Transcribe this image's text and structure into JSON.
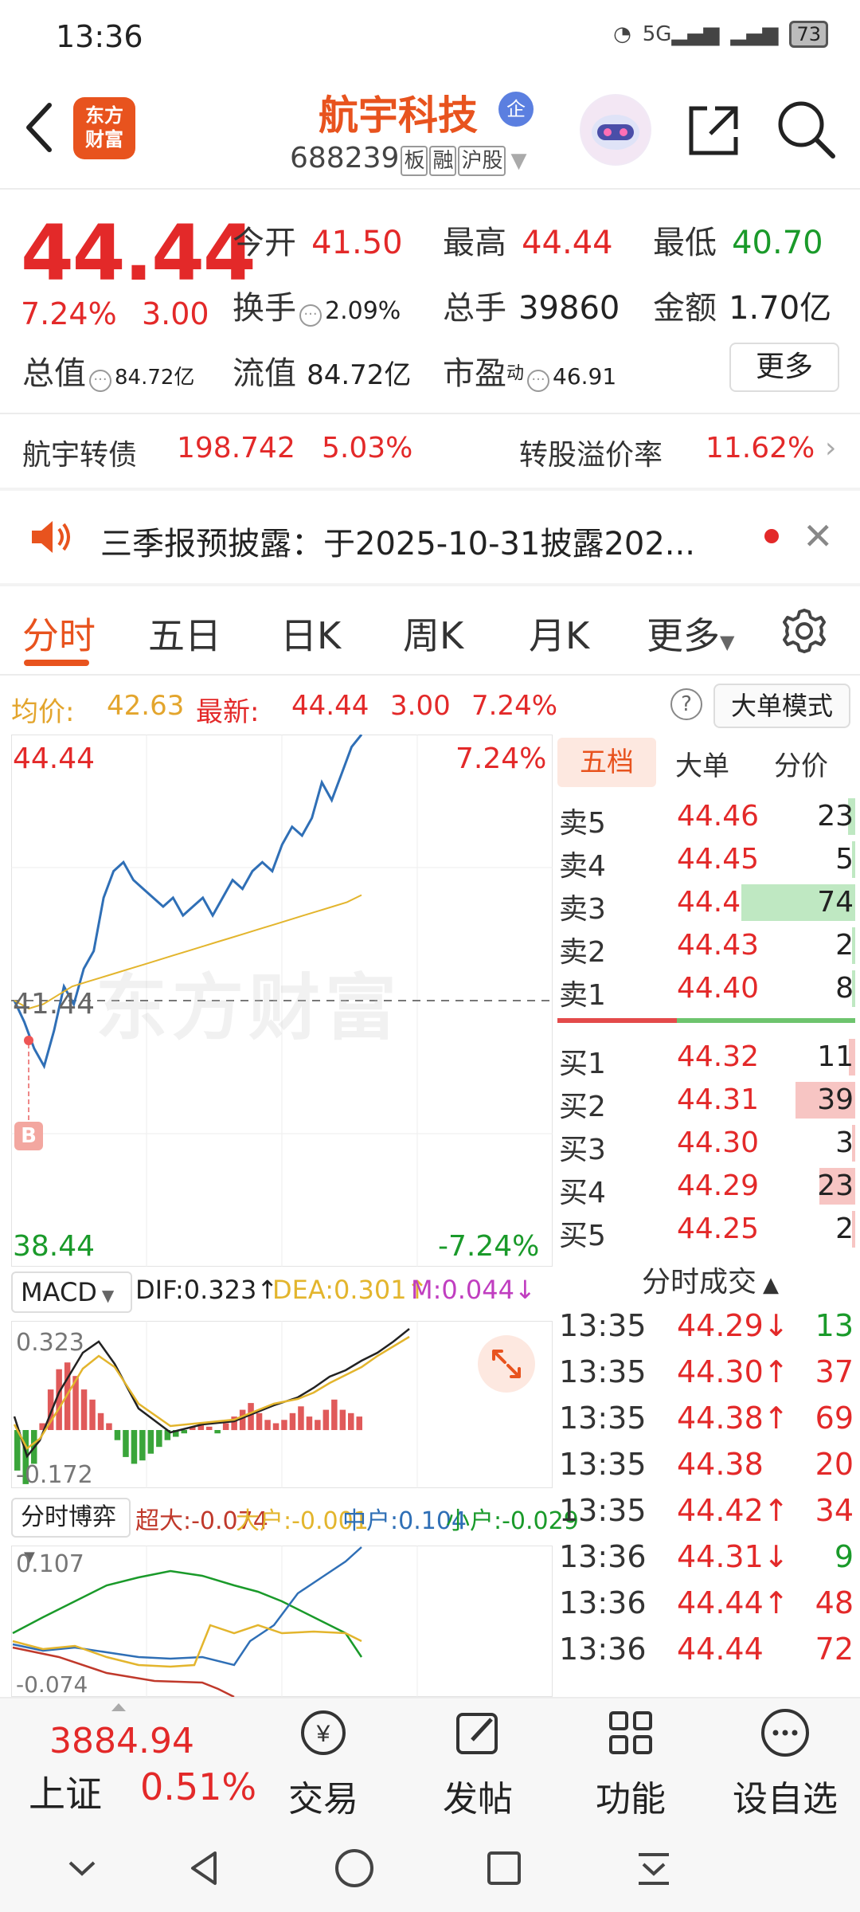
{
  "status": {
    "time": "13:36",
    "battery": "73",
    "network": "5G"
  },
  "header": {
    "app_logo_text": "东方财富",
    "stock_name": "航宇科技",
    "badge": "企",
    "stock_code": "688239",
    "tags": [
      "板",
      "融",
      "沪股"
    ]
  },
  "quote": {
    "price": "44.44",
    "change_pct": "7.24%",
    "change_val": "3.00",
    "open_label": "今开",
    "open": "41.50",
    "high_label": "最高",
    "high": "44.44",
    "low_label": "最低",
    "low": "40.70",
    "turnover_label": "换手",
    "turnover": "2.09%",
    "volume_label": "总手",
    "volume": "39860",
    "amount_label": "金额",
    "amount": "1.70亿",
    "mktcap_label": "总值",
    "mktcap": "84.72亿",
    "float_label": "流值",
    "float": "84.72亿",
    "pe_label": "市盈",
    "pe_sup": "动",
    "pe": "46.91",
    "more": "更多"
  },
  "bond": {
    "name": "航宇转债",
    "price": "198.742",
    "pct": "5.03%",
    "premium_label": "转股溢价率",
    "premium": "11.62%"
  },
  "notice": {
    "text": "三季报预披露：于2025-10-31披露202..."
  },
  "tabs": [
    "分时",
    "五日",
    "日K",
    "周K",
    "月K",
    "更多"
  ],
  "avg_row": {
    "avg_label": "均价:",
    "avg": "42.63",
    "last_label": "最新:",
    "last": "44.44",
    "chg": "3.00",
    "pct": "7.24%",
    "help": "?",
    "mode_btn": "大单模式"
  },
  "chart": {
    "top_price": "44.44",
    "top_pct": "7.24%",
    "mid_price": "41.44",
    "bottom_price": "38.44",
    "bottom_pct": "-7.24%",
    "watermark": "东方财富",
    "buy_marker": "B"
  },
  "chart_data": [
    {
      "type": "line",
      "title": "",
      "ylim": [
        38.44,
        44.44
      ],
      "prev_close": 41.44,
      "series": [
        {
          "name": "",
          "color": "#2f6fb6",
          "y": [
            41.44,
            41.2,
            40.9,
            40.7,
            41.1,
            41.6,
            41.4,
            41.8,
            42.0,
            42.6,
            42.9,
            43.0,
            42.8,
            42.7,
            42.6,
            42.5,
            42.6,
            42.4,
            42.5,
            42.6,
            42.4,
            42.6,
            42.8,
            42.7,
            42.9,
            43.0,
            42.9,
            43.2,
            43.4,
            43.3,
            43.5,
            43.9,
            43.7,
            44.0,
            44.3,
            44.44
          ]
        },
        {
          "name": "",
          "color": "#e3b52d",
          "y": [
            41.44,
            41.35,
            41.4,
            41.5,
            41.6,
            41.65,
            41.7,
            41.75,
            41.8,
            41.85,
            41.9,
            41.95,
            42.0,
            42.05,
            42.1,
            42.15,
            42.2,
            42.25,
            42.3,
            42.35,
            42.4,
            42.45,
            42.5,
            42.55,
            42.63
          ]
        }
      ]
    },
    {
      "type": "bar",
      "title": "MACD",
      "ylim": [
        -0.172,
        0.323
      ],
      "labels": {
        "dif": "DIF:0.323",
        "dea": "DEA:0.301",
        "m": "M:0.044"
      },
      "values": [
        -0.12,
        -0.16,
        -0.1,
        0.02,
        0.12,
        0.18,
        0.2,
        0.16,
        0.12,
        0.09,
        0.05,
        0.02,
        -0.03,
        -0.08,
        -0.1,
        -0.09,
        -0.07,
        -0.05,
        -0.03,
        -0.02,
        -0.01,
        0.01,
        0.02,
        0.01,
        -0.01,
        0.02,
        0.04,
        0.06,
        0.08,
        0.05,
        0.03,
        0.02,
        0.03,
        0.05,
        0.07,
        0.04,
        0.03,
        0.06,
        0.09,
        0.06,
        0.05,
        0.04
      ]
    },
    {
      "type": "line",
      "title": "分时博弈",
      "ylim": [
        -0.074,
        0.107
      ],
      "labels": {
        "l1": "超大:-0.074",
        "l2": "大户:-0.001",
        "l3": "中户:0.104",
        "l4": "小户:-0.029"
      },
      "legend_colors": {
        "超大": "#c0392b",
        "大户": "#e3b52d",
        "中户": "#2f6fb6",
        "小户": "#1a9a2a"
      }
    }
  ],
  "orderbook": {
    "tabs": [
      "五档",
      "大单",
      "分价"
    ],
    "asks": [
      {
        "label": "卖5",
        "price": "44.46",
        "vol": "23",
        "bar": 0.06
      },
      {
        "label": "卖4",
        "price": "44.45",
        "vol": "5",
        "bar": 0.02
      },
      {
        "label": "卖3",
        "price": "44.44",
        "vol": "74",
        "bar": 0.95
      },
      {
        "label": "卖2",
        "price": "44.43",
        "vol": "2",
        "bar": 0.01
      },
      {
        "label": "卖1",
        "price": "44.40",
        "vol": "8",
        "bar": 0.02
      }
    ],
    "bids": [
      {
        "label": "买1",
        "price": "44.32",
        "vol": "11",
        "bar": 0.05
      },
      {
        "label": "买2",
        "price": "44.31",
        "vol": "39",
        "bar": 0.5
      },
      {
        "label": "买3",
        "price": "44.30",
        "vol": "3",
        "bar": 0.01
      },
      {
        "label": "买4",
        "price": "44.29",
        "vol": "23",
        "bar": 0.3
      },
      {
        "label": "买5",
        "price": "44.25",
        "vol": "2",
        "bar": 0.01
      }
    ]
  },
  "macd_hdr": {
    "select": "MACD",
    "dif": "DIF:0.323",
    "dea": "DEA:0.301",
    "m": "M:0.044",
    "top": "0.323",
    "bottom": "-0.172"
  },
  "game_hdr": {
    "select": "分时博弈",
    "l1": "超大:-0.074",
    "l2": "大户:-0.001",
    "l3": "中户:0.104",
    "l4": "小户:-0.029",
    "top": "0.107",
    "bottom": "-0.074"
  },
  "ticks": {
    "header": "分时成交",
    "rows": [
      {
        "t": "13:35",
        "p": "44.29",
        "dir": "↓",
        "v": "13",
        "pc": "red",
        "vc": "green"
      },
      {
        "t": "13:35",
        "p": "44.30",
        "dir": "↑",
        "v": "37",
        "pc": "red",
        "vc": "red"
      },
      {
        "t": "13:35",
        "p": "44.38",
        "dir": "↑",
        "v": "69",
        "pc": "red",
        "vc": "red"
      },
      {
        "t": "13:35",
        "p": "44.38",
        "dir": "",
        "v": "20",
        "pc": "red",
        "vc": "red"
      },
      {
        "t": "13:35",
        "p": "44.42",
        "dir": "↑",
        "v": "34",
        "pc": "red",
        "vc": "red"
      },
      {
        "t": "13:36",
        "p": "44.31",
        "dir": "↓",
        "v": "9",
        "pc": "red",
        "vc": "green"
      },
      {
        "t": "13:36",
        "p": "44.44",
        "dir": "↑",
        "v": "48",
        "pc": "red",
        "vc": "red"
      },
      {
        "t": "13:36",
        "p": "44.44",
        "dir": "",
        "v": "72",
        "pc": "red",
        "vc": "red"
      }
    ]
  },
  "bottom": {
    "index_val": "3884.94",
    "index_name": "上证",
    "index_pct": "0.51%",
    "items": [
      "交易",
      "发帖",
      "功能",
      "设自选"
    ]
  },
  "colors": {
    "up": "#e32929",
    "down": "#1a9a2a",
    "accent": "#e8531e",
    "price_line": "#2f6fb6",
    "avg_line": "#e3b52d"
  }
}
